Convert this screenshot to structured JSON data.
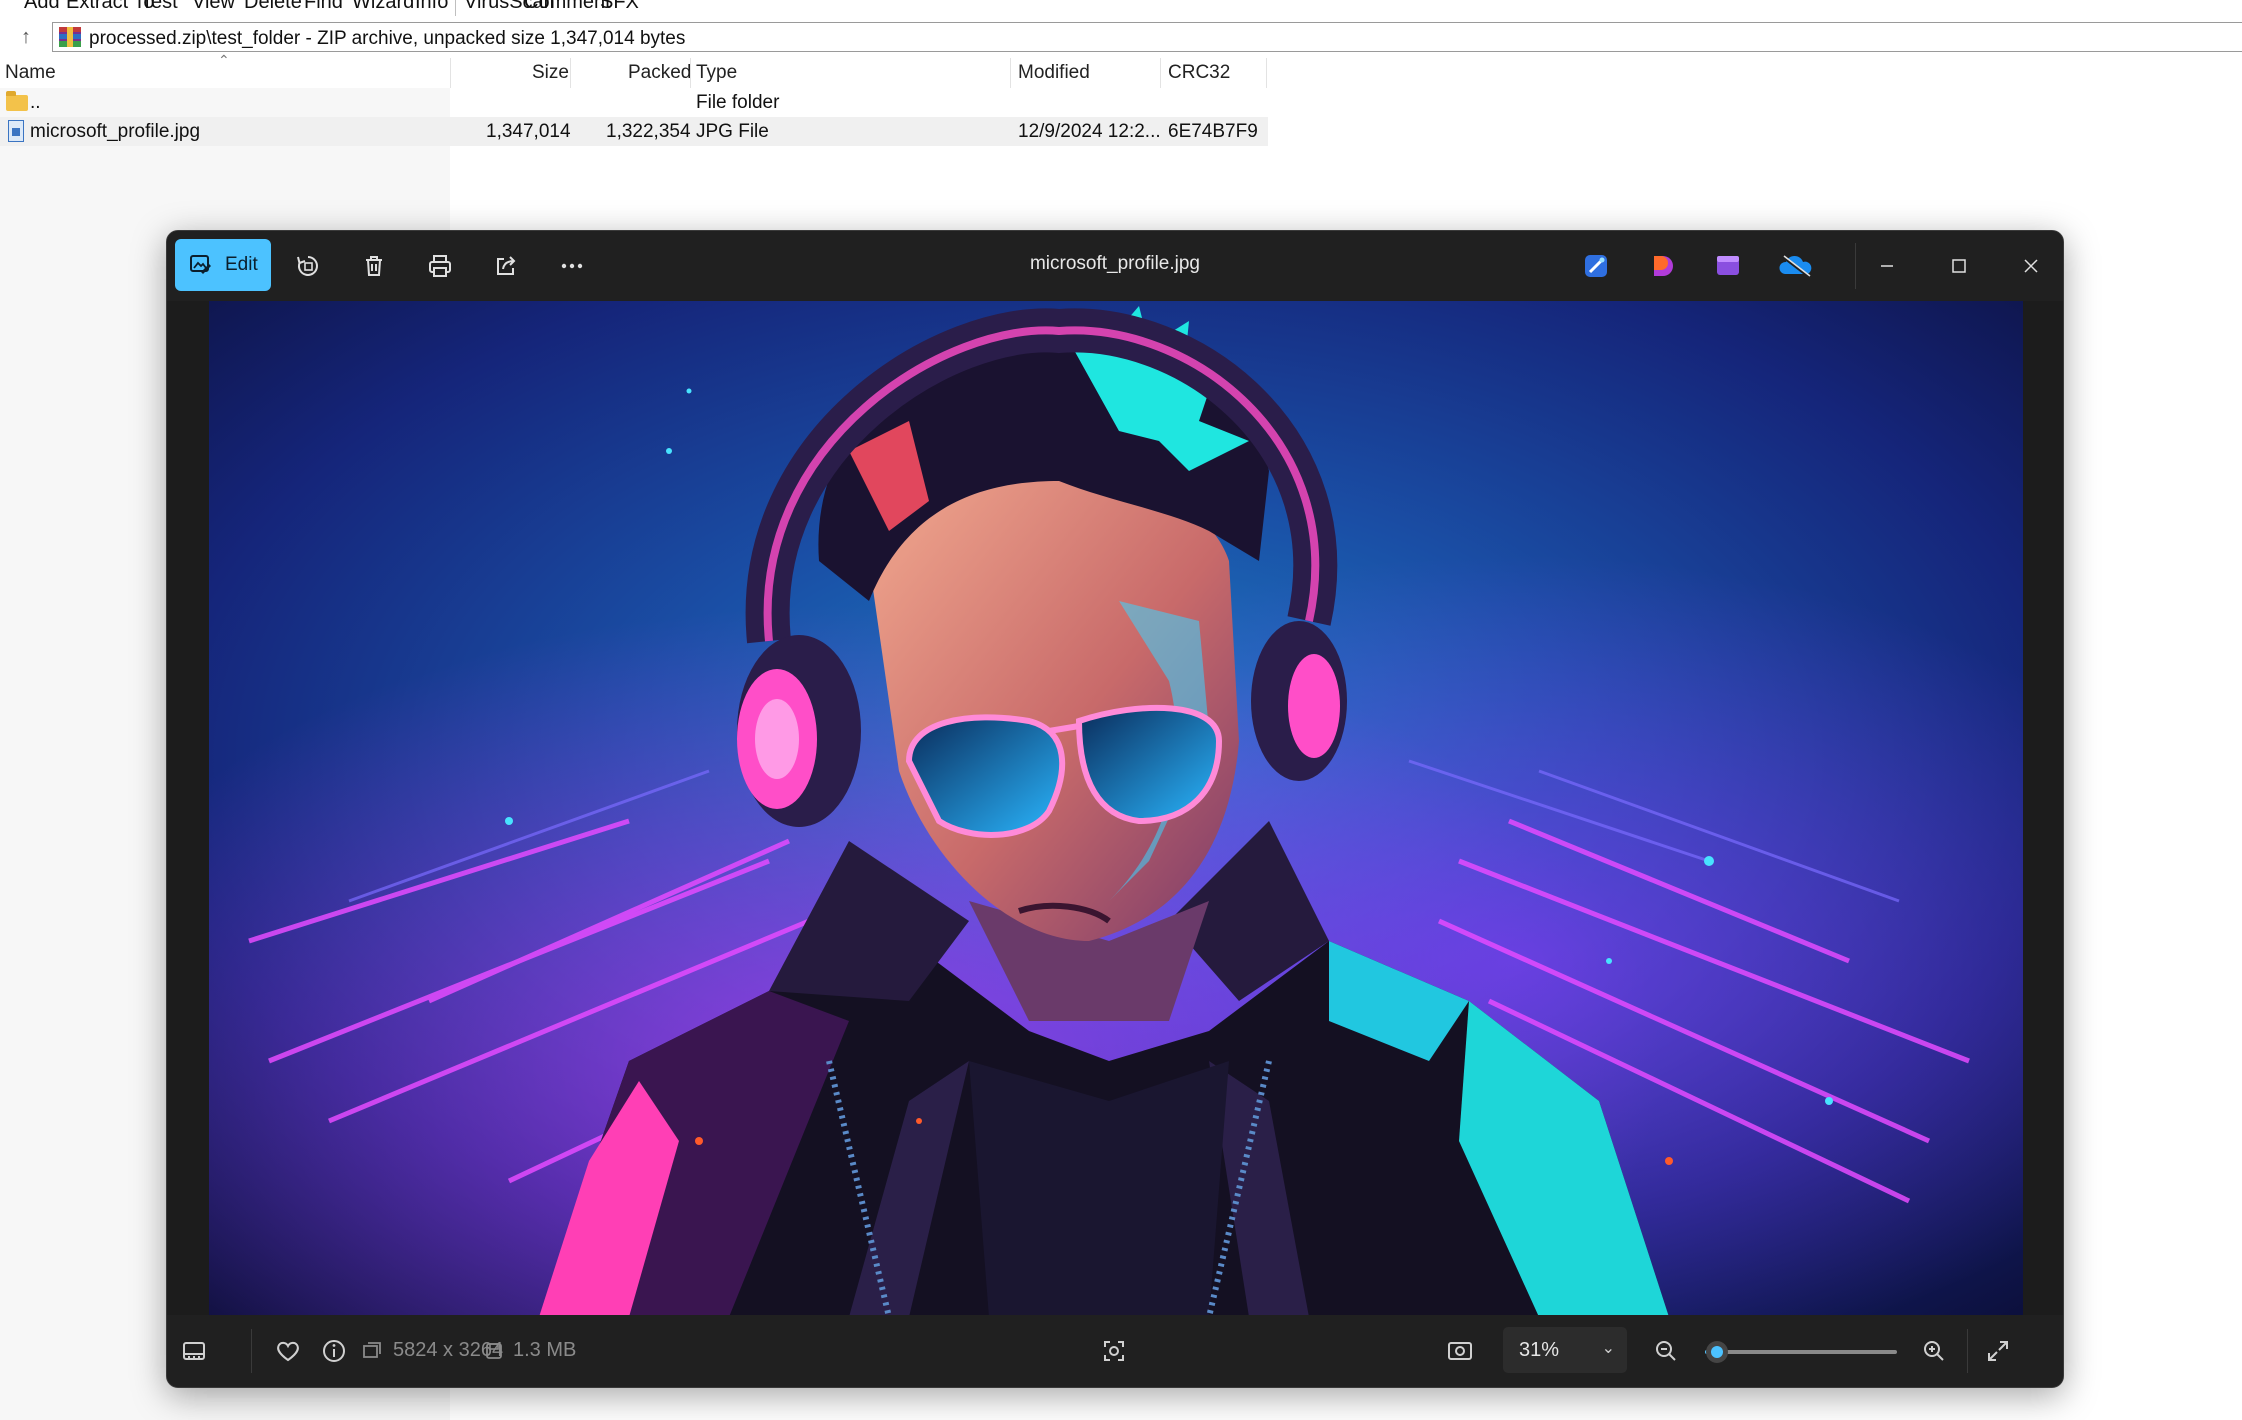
{
  "archive": {
    "toolbar": [
      "Add",
      "Extract To",
      "Test",
      "View",
      "Delete",
      "Find",
      "Wizard",
      "Info",
      "VirusScan",
      "Comment",
      "SFX"
    ],
    "address": "processed.zip\\test_folder - ZIP archive, unpacked size 1,347,014 bytes",
    "columns": {
      "name": "Name",
      "size": "Size",
      "packed": "Packed",
      "type": "Type",
      "modified": "Modified",
      "crc": "CRC32"
    },
    "rows": [
      {
        "name": "..",
        "size": "",
        "packed": "",
        "type": "File folder",
        "modified": "",
        "crc": ""
      },
      {
        "name": "microsoft_profile.jpg",
        "size": "1,347,014",
        "packed": "1,322,354",
        "type": "JPG File",
        "modified": "12/9/2024 12:2...",
        "crc": "6E74B7F9"
      }
    ]
  },
  "photos": {
    "title": "microsoft_profile.jpg",
    "edit_label": "Edit",
    "toolbar_icons": [
      "rotate-icon",
      "delete-icon",
      "print-icon",
      "share-icon",
      "more-icon"
    ],
    "app_icons": [
      "designer-icon",
      "clipchamp-icon",
      "video-editor-icon",
      "onedrive-icon"
    ],
    "dimensions": "5824 x 3264",
    "file_size": "1.3 MB",
    "zoom": "31%",
    "zoom_fraction": 0.06,
    "colors": {
      "accent": "#4cc2ff",
      "bar": "#202020"
    }
  }
}
